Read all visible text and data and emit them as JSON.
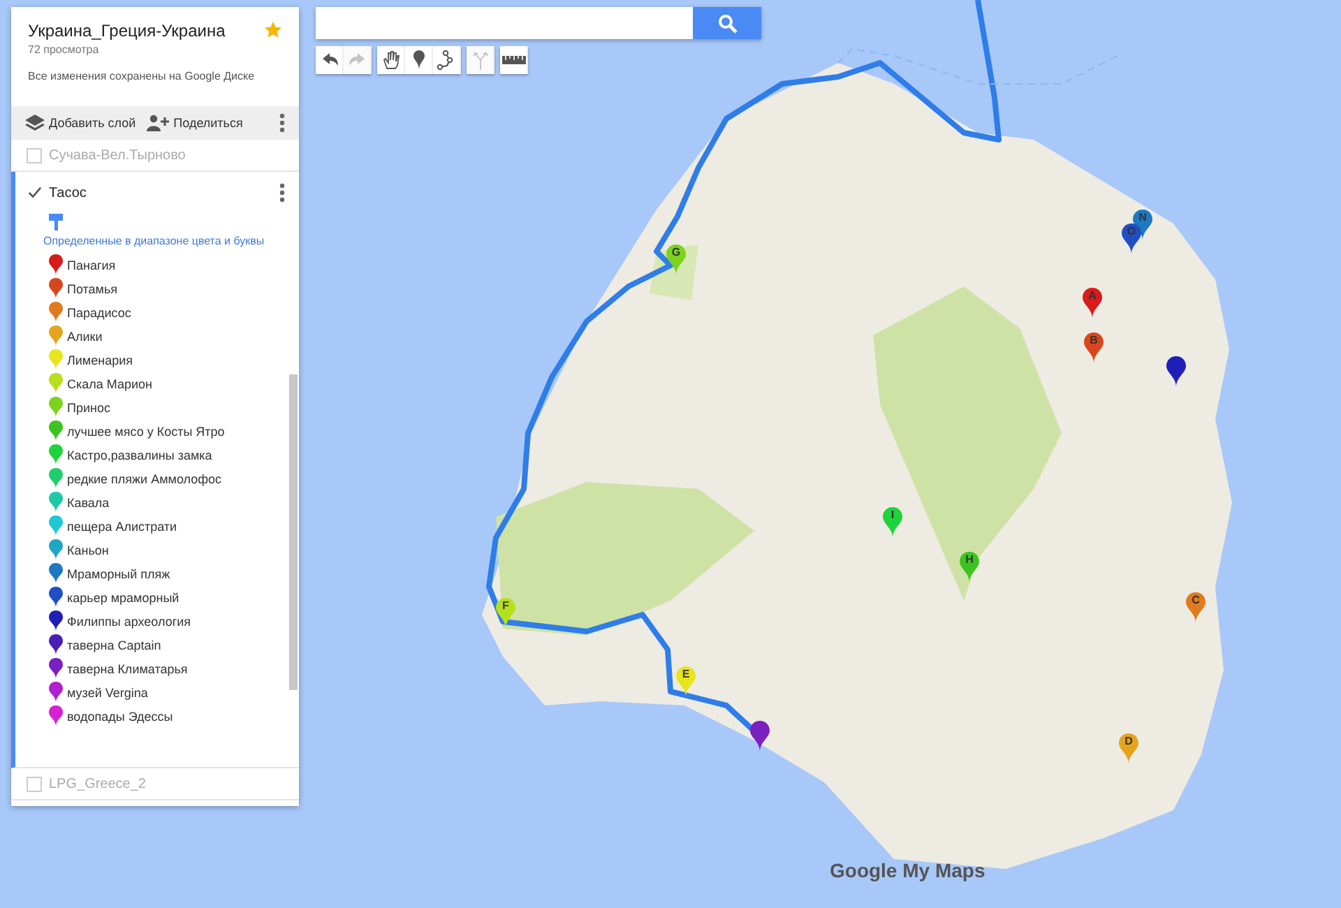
{
  "map_title": "Украина_Греция-Украина",
  "views": "72 просмотра",
  "save_status": "Все изменения сохранены на Google Диске",
  "actions": [
    {
      "kind": "layer",
      "label": "Добавить слой"
    },
    {
      "kind": "share",
      "label": "Поделиться"
    }
  ],
  "layers": [
    {
      "name": "Сучава-Вел.Тырново",
      "checked": false,
      "expanded": false
    },
    {
      "name": "Тасос",
      "checked": true,
      "expanded": true,
      "style_link": "Определенные в диапазоне цвета и буквы",
      "places": [
        {
          "name": "Панагия",
          "color": "#d91b1b"
        },
        {
          "name": "Потамья",
          "color": "#d9461b"
        },
        {
          "name": "Парадисос",
          "color": "#e07b1e"
        },
        {
          "name": "Алики",
          "color": "#e3a51c"
        },
        {
          "name": "Лименария",
          "color": "#e8e51c"
        },
        {
          "name": "Скала Марион",
          "color": "#b7e01c"
        },
        {
          "name": "Принос",
          "color": "#7dd31c"
        },
        {
          "name": "лучшее мясо у Косты Ятро",
          "color": "#3bc41f"
        },
        {
          "name": "Кастро,развалины замка",
          "color": "#1fd33a"
        },
        {
          "name": "редкие пляжи Аммолофос",
          "color": "#1fcf6e"
        },
        {
          "name": "Кавала",
          "color": "#1fc9a8"
        },
        {
          "name": "пещера Алистрати",
          "color": "#1fc7d3"
        },
        {
          "name": "Каньон",
          "color": "#1fa6c3"
        },
        {
          "name": "Мраморный пляж",
          "color": "#1f78c3"
        },
        {
          "name": "карьер мраморный",
          "color": "#1f4fc3"
        },
        {
          "name": "Филиппы археология",
          "color": "#1f1fb8"
        },
        {
          "name": "таверна Captain",
          "color": "#4a1fb8"
        },
        {
          "name": "таверна Климатарья",
          "color": "#7a1fc0"
        },
        {
          "name": "музей Vergina",
          "color": "#b01fd0"
        },
        {
          "name": "водопады Эдессы",
          "color": "#d81fd3"
        }
      ]
    },
    {
      "name": "LPG_Greece_2",
      "checked": false,
      "expanded": false
    }
  ],
  "tools": [
    {
      "kind": "undo",
      "disabled": false
    },
    {
      "kind": "redo",
      "disabled": true
    },
    {
      "kind": "hand",
      "disabled": false
    },
    {
      "kind": "marker",
      "disabled": false
    },
    {
      "kind": "line",
      "disabled": false
    },
    {
      "kind": "directions",
      "disabled": true
    },
    {
      "kind": "ruler",
      "disabled": false
    }
  ],
  "markers": [
    {
      "letter": "A",
      "color": "#d91b1b"
    },
    {
      "letter": "B",
      "color": "#d9461b"
    },
    {
      "letter": "C",
      "color": "#e07b1e"
    },
    {
      "letter": "D",
      "color": "#e3a51c"
    },
    {
      "letter": "E",
      "color": "#e8e51c"
    },
    {
      "letter": "F",
      "color": "#b7e01c"
    },
    {
      "letter": "G",
      "color": "#7dd31c"
    },
    {
      "letter": "H",
      "color": "#3bc41f"
    },
    {
      "letter": "I",
      "color": "#1fd33a"
    },
    {
      "letter": "N",
      "color": "#1f78c3"
    },
    {
      "letter": "O",
      "color": "#1f4fc3"
    },
    {
      "color": "#1f1fb8"
    },
    {
      "color": "#7a1fc0"
    }
  ],
  "map_logo": "Google My Maps"
}
